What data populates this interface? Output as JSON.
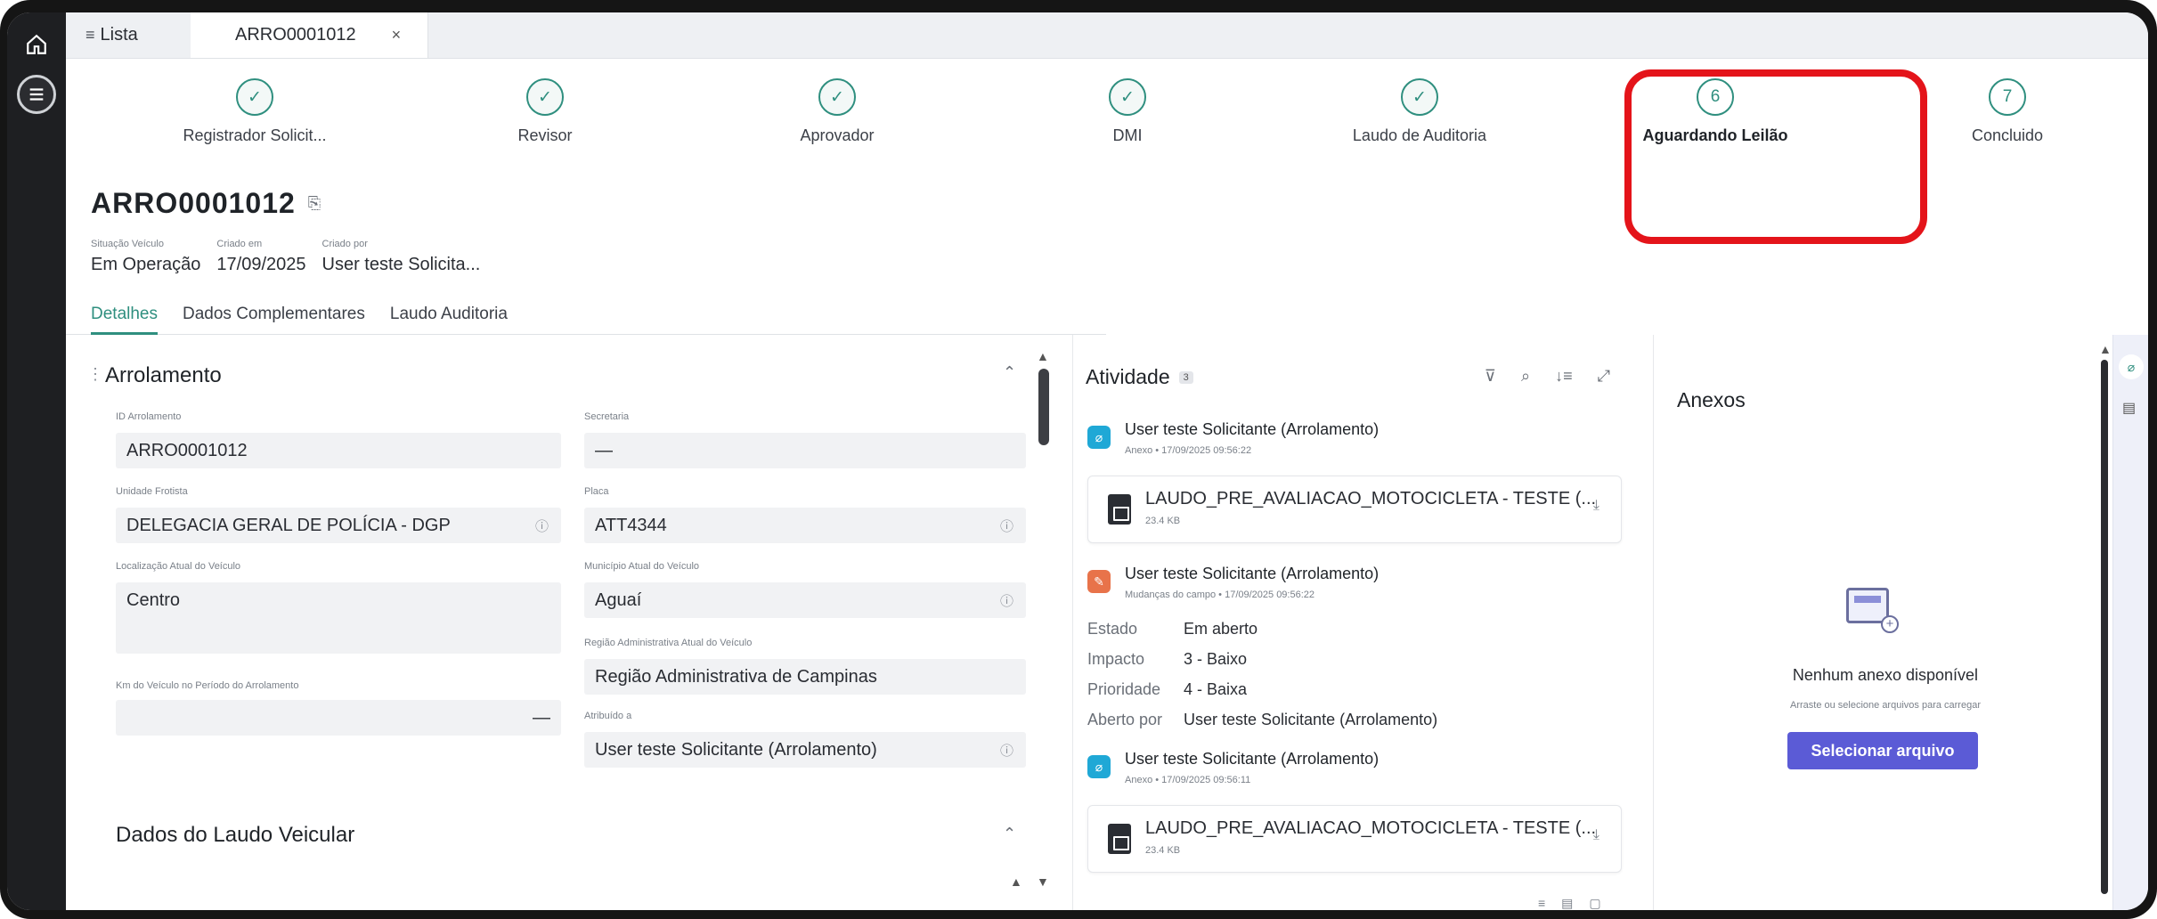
{
  "tabs": {
    "list_label": "Lista",
    "active_label": "ARRO0001012",
    "close": "×"
  },
  "stepper": [
    {
      "label": "Registrador Solicit...",
      "icon": "check-icon",
      "state": "done"
    },
    {
      "label": "Revisor",
      "icon": "check-icon",
      "state": "done"
    },
    {
      "label": "Aprovador",
      "icon": "check-icon",
      "state": "done"
    },
    {
      "label": "DMI",
      "icon": "check-icon",
      "state": "done"
    },
    {
      "label": "Laudo de Auditoria",
      "icon": "check-icon",
      "state": "done"
    },
    {
      "label": "Aguardando Leilão",
      "number": "6",
      "state": "current"
    },
    {
      "label": "Concluido",
      "number": "7",
      "state": "pending"
    }
  ],
  "record": {
    "id": "ARRO0001012",
    "meta": [
      {
        "label": "Situação Veículo",
        "value": "Em Operação"
      },
      {
        "label": "Criado em",
        "value": "17/09/2025"
      },
      {
        "label": "Criado por",
        "value": "User teste Solicita..."
      }
    ]
  },
  "detail_tabs": [
    "Detalhes",
    "Dados Complementares",
    "Laudo Auditoria"
  ],
  "form": {
    "section_title": "Arrolamento",
    "section2_title": "Dados do Laudo Veicular",
    "fields": {
      "id_label": "ID Arrolamento",
      "id_value": "ARRO0001012",
      "secretaria_label": "Secretaria",
      "secretaria_value": "—",
      "unidade_label": "Unidade Frotista",
      "unidade_value": "DELEGACIA GERAL DE POLÍCIA - DGP",
      "placa_label": "Placa",
      "placa_value": "ATT4344",
      "localizacao_label": "Localização Atual do Veículo",
      "localizacao_value": "Centro",
      "municipio_label": "Município Atual do Veículo",
      "municipio_value": "Aguaí",
      "regiao_label": "Região Administrativa Atual do Veículo",
      "regiao_value": "Região Administrativa de Campinas",
      "km_label": "Km do Veículo no Período do Arrolamento",
      "km_value": "—",
      "atribuido_label": "Atribuído a",
      "atribuido_value": "User teste Solicitante (Arrolamento)"
    }
  },
  "activity": {
    "title": "Atividade",
    "count": "3",
    "entries": [
      {
        "who": "User teste Solicitante (Arrolamento)",
        "sub": "Anexo • 17/09/2025 09:56:22",
        "icon": "paperclip-icon",
        "color": "#1fa8d6"
      },
      {
        "who": "User teste Solicitante (Arrolamento)",
        "sub": "Mudanças do campo • 17/09/2025 09:56:22",
        "icon": "pencil-icon",
        "color": "#e8734a"
      },
      {
        "who": "User teste Solicitante (Arrolamento)",
        "sub": "Anexo • 17/09/2025 09:56:11",
        "icon": "paperclip-icon",
        "color": "#1fa8d6"
      }
    ],
    "files": [
      {
        "name": "LAUDO_PRE_AVALIACAO_MOTOCICLETA - TESTE (...",
        "size": "23.4 KB"
      },
      {
        "name": "LAUDO_PRE_AVALIACAO_MOTOCICLETA - TESTE (...",
        "size": "23.4 KB"
      }
    ],
    "changes": [
      {
        "k": "Estado",
        "v": "Em aberto"
      },
      {
        "k": "Impacto",
        "v": "3 - Baixo"
      },
      {
        "k": "Prioridade",
        "v": "4 - Baixa"
      },
      {
        "k": "Aberto por",
        "v": "User teste Solicitante (Arrolamento)"
      }
    ]
  },
  "anexos": {
    "title": "Anexos",
    "empty_title": "Nenhum anexo disponível",
    "empty_sub": "Arraste ou selecione arquivos para carregar",
    "button": "Selecionar arquivo"
  },
  "colors": {
    "accent": "#2f8f7f",
    "highlight": "#e4141a",
    "primary_button": "#5b5bd6"
  }
}
